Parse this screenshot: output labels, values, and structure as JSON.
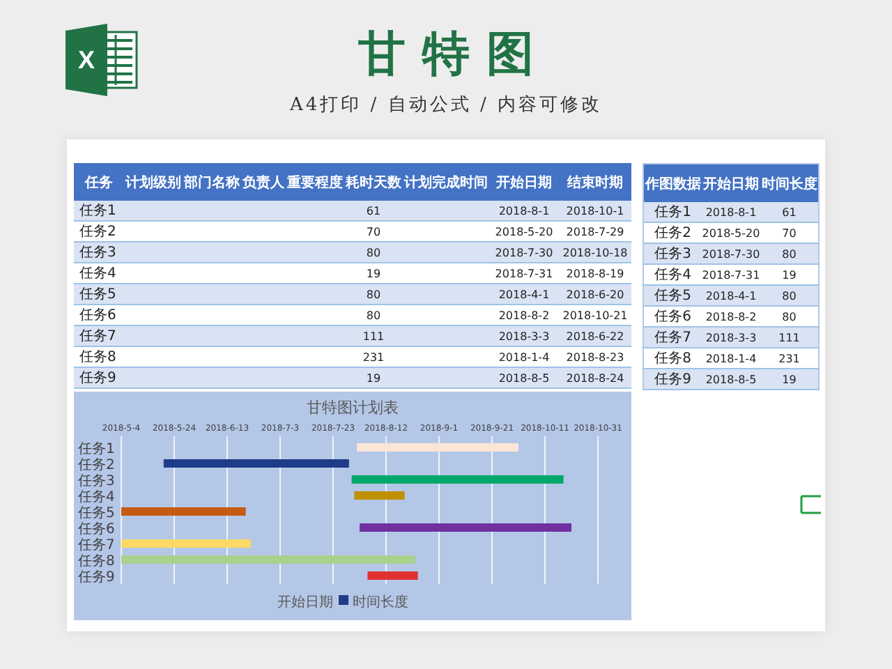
{
  "header": {
    "logo_letter": "X",
    "title": "甘特图",
    "subtitle": "A4打印 / 自动公式 / 内容可修改"
  },
  "main_table": {
    "columns": [
      "任务",
      "计划级别",
      "部门名称",
      "负责人",
      "重要程度",
      "耗时天数",
      "计划完成时间",
      "开始日期",
      "结束时期"
    ],
    "rows": [
      {
        "task": "任务1",
        "days": "61",
        "start": "2018-8-1",
        "end": "2018-10-1"
      },
      {
        "task": "任务2",
        "days": "70",
        "start": "2018-5-20",
        "end": "2018-7-29"
      },
      {
        "task": "任务3",
        "days": "80",
        "start": "2018-7-30",
        "end": "2018-10-18"
      },
      {
        "task": "任务4",
        "days": "19",
        "start": "2018-7-31",
        "end": "2018-8-19"
      },
      {
        "task": "任务5",
        "days": "80",
        "start": "2018-4-1",
        "end": "2018-6-20"
      },
      {
        "task": "任务6",
        "days": "80",
        "start": "2018-8-2",
        "end": "2018-10-21"
      },
      {
        "task": "任务7",
        "days": "111",
        "start": "2018-3-3",
        "end": "2018-6-22"
      },
      {
        "task": "任务8",
        "days": "231",
        "start": "2018-1-4",
        "end": "2018-8-23"
      },
      {
        "task": "任务9",
        "days": "19",
        "start": "2018-8-5",
        "end": "2018-8-24"
      }
    ]
  },
  "side_table": {
    "columns": [
      "作图数据",
      "开始日期",
      "时间长度"
    ],
    "rows": [
      [
        "任务1",
        "2018-8-1",
        "61"
      ],
      [
        "任务2",
        "2018-5-20",
        "70"
      ],
      [
        "任务3",
        "2018-7-30",
        "80"
      ],
      [
        "任务4",
        "2018-7-31",
        "19"
      ],
      [
        "任务5",
        "2018-4-1",
        "80"
      ],
      [
        "任务6",
        "2018-8-2",
        "80"
      ],
      [
        "任务7",
        "2018-3-3",
        "111"
      ],
      [
        "任务8",
        "2018-1-4",
        "231"
      ],
      [
        "任务9",
        "2018-8-5",
        "19"
      ]
    ]
  },
  "chart": {
    "title": "甘特图计划表",
    "axis_labels": [
      "2018-5-4",
      "2018-5-24",
      "2018-6-13",
      "2018-7-3",
      "2018-7-23",
      "2018-8-12",
      "2018-9-1",
      "2018-9-21",
      "2018-10-11",
      "2018-10-31"
    ],
    "category_labels": [
      "任务1",
      "任务2",
      "任务3",
      "任务4",
      "任务5",
      "任务6",
      "任务7",
      "任务8",
      "任务9"
    ],
    "legend": [
      {
        "label": "开始日期"
      },
      {
        "label": "时间长度",
        "color": "#1f3c88"
      }
    ]
  }
}
